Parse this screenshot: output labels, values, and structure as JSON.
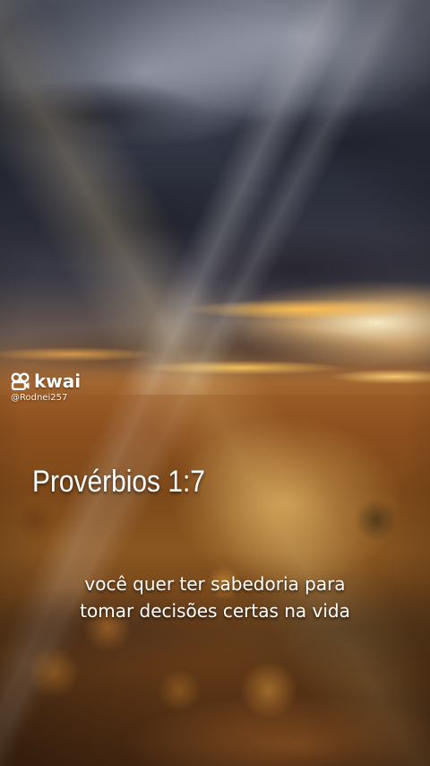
{
  "watermark": {
    "brand": "kwai",
    "handle": "@Rodnei257",
    "logo_icon": "kwai-logo-icon"
  },
  "verse": {
    "reference": "Provérbios 1:7"
  },
  "captions": {
    "line1": "você quer ter sabedoria para",
    "line2": "tomar decisões certas na vida"
  },
  "colors": {
    "text": "#ffffff",
    "sunlight": "#ffb84d",
    "cloud_dark": "#2b2e3b"
  }
}
